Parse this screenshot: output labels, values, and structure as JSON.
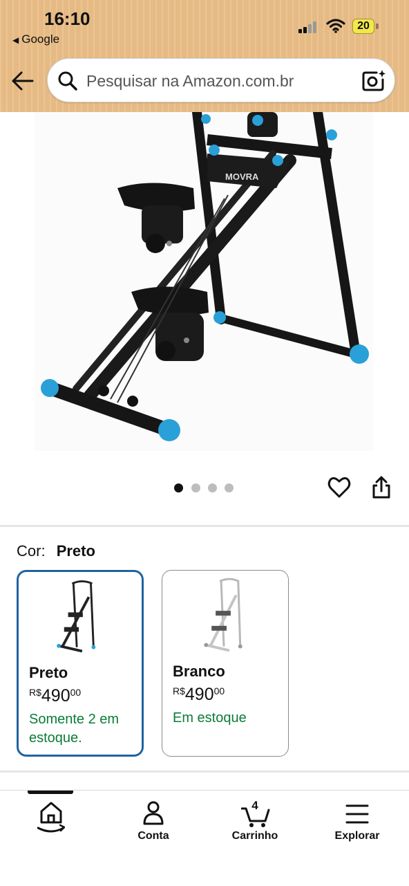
{
  "status_bar": {
    "time": "16:10",
    "back_app": "Google",
    "battery": "20"
  },
  "search": {
    "placeholder": "Pesquisar na Amazon.com.br"
  },
  "product": {
    "image_icon": "abdominal-machine-image",
    "brand_on_image": "MOVRA",
    "carousel": {
      "total": 4,
      "active": 1
    }
  },
  "color_selector": {
    "label": "Cor:",
    "selected": "Preto",
    "options": [
      {
        "name": "Preto",
        "currency": "R$",
        "price_whole": "490",
        "price_cents": "00",
        "stock": "Somente 2 em estoque."
      },
      {
        "name": "Branco",
        "currency": "R$",
        "price_whole": "490",
        "price_cents": "00",
        "stock": "Em estoque"
      }
    ]
  },
  "bottom_nav": {
    "items": [
      {
        "label": "",
        "icon": "home-icon"
      },
      {
        "label": "Conta",
        "icon": "account-icon"
      },
      {
        "label": "Carrinho",
        "icon": "cart-icon",
        "count": "4"
      },
      {
        "label": "Explorar",
        "icon": "menu-icon"
      }
    ]
  },
  "colors": {
    "header_bg": "#ecc089",
    "selected_border": "#2162a1",
    "stock_green": "#0b7c36",
    "accent_blue": "#2aa0d8"
  }
}
